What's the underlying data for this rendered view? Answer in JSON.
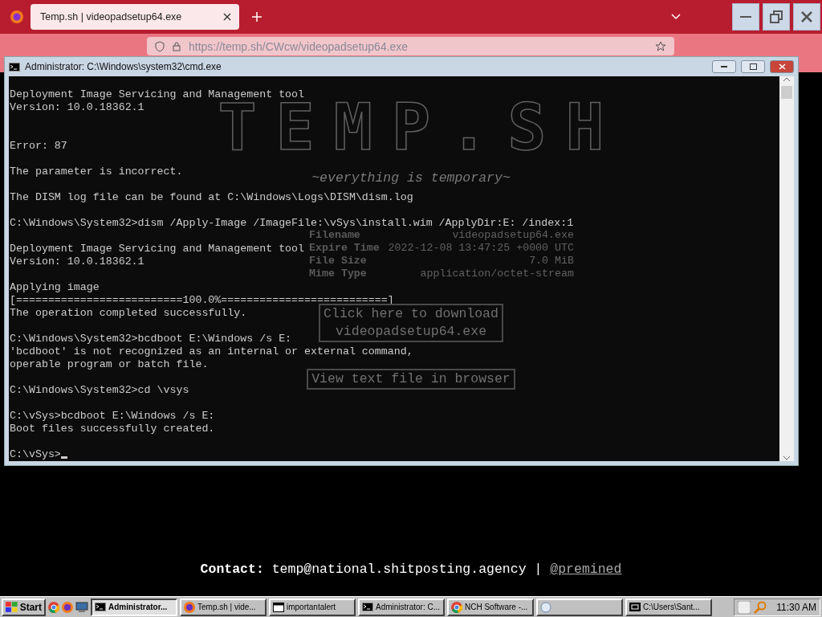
{
  "browser": {
    "tabs": [
      {
        "label": "Temp.sh | videopadsetup64.exe",
        "selected": true
      }
    ],
    "url": "https://temp.sh/CWcw/videopadsetup64.exe"
  },
  "page": {
    "logo": "TEMP.SH",
    "tagline": "~everything is temporary~",
    "file_info": [
      {
        "label": "Filename",
        "value": "videopadsetup64.exe"
      },
      {
        "label": "Expire Time",
        "value": "2022-12-08 13:47:25 +0000 UTC"
      },
      {
        "label": "File Size",
        "value": "7.0 MiB"
      },
      {
        "label": "Mime Type",
        "value": "application/octet-stream"
      }
    ],
    "download_button": [
      "Click here to download",
      "videopadsetup64.exe"
    ],
    "view_button": "View text file in browser",
    "contact": {
      "text": "**Contact:** temp@national.shitposting.agency | ",
      "link": "@premined"
    }
  },
  "console_window": {
    "title": "Administrator: C:\\Windows\\system32\\cmd.exe",
    "lines": [
      {
        "kind": "text",
        "text": "Deployment Image Servicing and Management tool"
      },
      {
        "kind": "text",
        "text": "Version: 10.0.18362.1"
      },
      {
        "kind": "blank"
      },
      {
        "kind": "blank"
      },
      {
        "kind": "text",
        "text": "Error: 87"
      },
      {
        "kind": "blank"
      },
      {
        "kind": "text",
        "text": "The parameter is incorrect."
      },
      {
        "kind": "blank"
      },
      {
        "kind": "text",
        "text": "The DISM log file can be found at C:\\Windows\\Logs\\DISM\\dism.log"
      },
      {
        "kind": "blank"
      },
      {
        "kind": "text",
        "text": "C:\\Windows\\System32>dism /Apply-Image /ImageFile:\\vSys\\install.wim /ApplyDir:E: /index:1"
      },
      {
        "kind": "blank"
      },
      {
        "kind": "text",
        "text": "Deployment Image Servicing and Management tool"
      },
      {
        "kind": "text",
        "text": "Version: 10.0.18362.1"
      },
      {
        "kind": "blank"
      },
      {
        "kind": "text",
        "text": "Applying image"
      },
      {
        "kind": "text",
        "text": "[==========================100.0%==========================]"
      },
      {
        "kind": "text",
        "text": "The operation completed successfully."
      },
      {
        "kind": "blank"
      },
      {
        "kind": "text",
        "text": "C:\\Windows\\System32>bcdboot E:\\Windows /s E:"
      },
      {
        "kind": "text",
        "text": "'bcdboot' is not recognized as an internal or external command,"
      },
      {
        "kind": "text",
        "text": "operable program or batch file."
      },
      {
        "kind": "blank"
      },
      {
        "kind": "text",
        "text": "C:\\Windows\\System32>cd \\vsys"
      },
      {
        "kind": "blank"
      },
      {
        "kind": "text",
        "text": "C:\\vSys>bcdboot E:\\Windows /s E:"
      },
      {
        "kind": "text",
        "text": "Boot files successfully created."
      },
      {
        "kind": "blank"
      },
      {
        "kind": "prompt",
        "text": "C:\\vSys>"
      }
    ]
  },
  "taskbar": {
    "start": "Start",
    "tasks": [
      {
        "kind": "console",
        "label": "Administrator...",
        "selected": true
      },
      {
        "kind": "browser",
        "label": "Temp.sh | vide...",
        "selected": false
      },
      {
        "kind": "window",
        "label": "importantalert",
        "selected": false
      },
      {
        "kind": "console",
        "label": "Administrator: C...",
        "selected": false
      },
      {
        "kind": "chrome",
        "label": "NCH Software -...",
        "selected": false
      },
      {
        "kind": "blank",
        "selected": false
      },
      {
        "kind": "archive",
        "label": "C:\\Users\\Sant...",
        "selected": false
      }
    ],
    "clock": "11:30 AM"
  }
}
